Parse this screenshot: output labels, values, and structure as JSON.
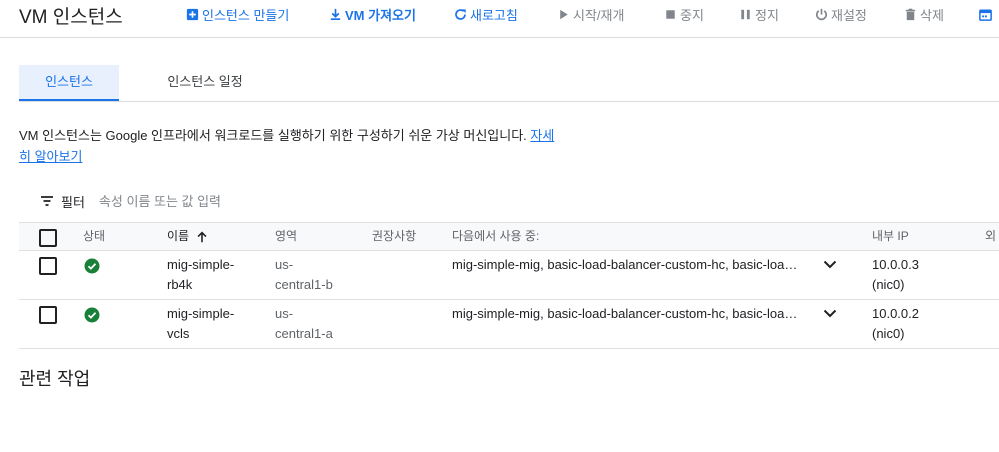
{
  "header": {
    "title": "VM 인스턴스",
    "actions": {
      "create": "인스턴스 만들기",
      "import_vm": "VM 가져오기",
      "refresh": "새로고침",
      "start": "시작/재개",
      "stop": "중지",
      "suspend": "정지",
      "reset": "재설정",
      "delete": "삭제"
    }
  },
  "tabs": [
    {
      "label": "인스턴스",
      "active": true
    },
    {
      "label": "인스턴스 일정",
      "active": false
    }
  ],
  "description": {
    "text": "VM 인스턴스는 Google 인프라에서 워크로드를 실행하기 위한 구성하기 쉬운 가상 머신입니다. ",
    "link": "자세히 알아보기"
  },
  "filter": {
    "label": "필터",
    "placeholder": "속성 이름 또는 값 입력"
  },
  "table": {
    "columns": {
      "status": "상태",
      "name": "이름",
      "zone": "영역",
      "recommendation": "권장사항",
      "in_use_by": "다음에서 사용 중:",
      "internal_ip": "내부 IP",
      "external_ip": "외"
    },
    "rows": [
      {
        "status": "running",
        "name_line1": "mig-simple-",
        "name_line2": "rb4k",
        "zone_line1": "us-",
        "zone_line2": "central1-b",
        "in_use_by": "mig-simple-mig, basic-load-balancer-custom-hc, basic-load-balancer",
        "ip_line1": "10.0.0.3",
        "ip_line2": "(nic0)"
      },
      {
        "status": "running",
        "name_line1": "mig-simple-",
        "name_line2": "vcls",
        "zone_line1": "us-",
        "zone_line2": "central1-a",
        "in_use_by": "mig-simple-mig, basic-load-balancer-custom-hc, basic-load-balancer",
        "ip_line1": "10.0.0.2",
        "ip_line2": "(nic0)"
      }
    ]
  },
  "related": {
    "title": "관련 작업"
  },
  "colors": {
    "accent": "#1a73e8",
    "status_ok": "#188038",
    "disabled": "#80868b"
  }
}
